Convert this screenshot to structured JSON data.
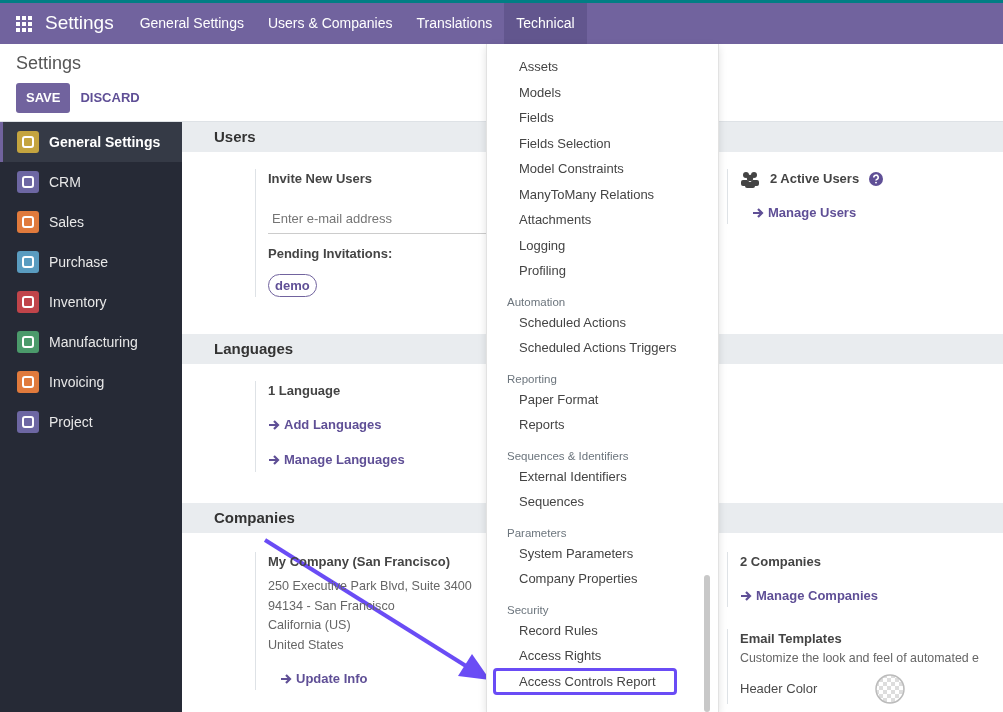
{
  "navbar": {
    "app_title": "Settings",
    "menus": [
      {
        "label": "General Settings",
        "selected": false
      },
      {
        "label": "Users & Companies",
        "selected": false
      },
      {
        "label": "Translations",
        "selected": false
      },
      {
        "label": "Technical",
        "selected": true
      }
    ]
  },
  "control_panel": {
    "title": "Settings",
    "buttons": [
      {
        "label": "SAVE",
        "kind": "primary"
      },
      {
        "label": "DISCARD",
        "kind": "link"
      }
    ]
  },
  "sidebar": {
    "items": [
      {
        "label": "General Settings",
        "selected": true,
        "color": "#c4a43f"
      },
      {
        "label": "CRM",
        "selected": false,
        "color": "#6d67a3"
      },
      {
        "label": "Sales",
        "selected": false,
        "color": "#e07a3c"
      },
      {
        "label": "Purchase",
        "selected": false,
        "color": "#5a9cc0"
      },
      {
        "label": "Inventory",
        "selected": false,
        "color": "#c0444a"
      },
      {
        "label": "Manufacturing",
        "selected": false,
        "color": "#4b9a6b"
      },
      {
        "label": "Invoicing",
        "selected": false,
        "color": "#e07a3c"
      },
      {
        "label": "Project",
        "selected": false,
        "color": "#6d67a3"
      }
    ]
  },
  "sections": [
    {
      "title": "Users",
      "left": [
        {
          "kind": "heading",
          "text": "Invite New Users"
        },
        {
          "kind": "field",
          "placeholder": "Enter e-mail address"
        },
        {
          "kind": "heading",
          "text": "Pending Invitations:"
        },
        {
          "kind": "badge",
          "text": "demo"
        }
      ],
      "right": [
        {
          "kind": "users_stat",
          "text": "2 Active Users"
        },
        {
          "kind": "link",
          "text": "Manage Users",
          "indent": true
        }
      ]
    },
    {
      "title": "Languages",
      "left": [
        {
          "kind": "heading",
          "text": "1 Language"
        },
        {
          "kind": "link",
          "text": "Add Languages"
        },
        {
          "kind": "link",
          "text": "Manage Languages"
        }
      ]
    },
    {
      "title": "Companies",
      "left": [
        {
          "kind": "heading",
          "text": "My Company (San Francisco)"
        },
        {
          "kind": "address",
          "lines": [
            "250 Executive Park Blvd, Suite 3400",
            "94134 - San Francisco",
            "California (US)",
            "United States"
          ]
        },
        {
          "kind": "link",
          "text": "Update Info",
          "indent": true
        }
      ],
      "right": [
        {
          "kind": "heading",
          "text": "2 Companies"
        },
        {
          "kind": "link",
          "text": "Manage Companies"
        },
        {
          "kind": "setting",
          "title": "Email Templates",
          "description": "Customize the look and feel of automated e",
          "options": [
            {
              "label": "Header Color"
            }
          ]
        }
      ]
    }
  ],
  "technical_menu": {
    "sections": [
      {
        "items": [
          {
            "label": "Assets",
            "highlighted": false
          },
          {
            "label": "Models",
            "highlighted": false
          },
          {
            "label": "Fields",
            "highlighted": false
          },
          {
            "label": "Fields Selection",
            "highlighted": false
          },
          {
            "label": "Model Constraints",
            "highlighted": false
          },
          {
            "label": "ManyToMany Relations",
            "highlighted": false
          },
          {
            "label": "Attachments",
            "highlighted": false
          },
          {
            "label": "Logging",
            "highlighted": false
          },
          {
            "label": "Profiling",
            "highlighted": false
          }
        ]
      },
      {
        "header": "Automation",
        "items": [
          {
            "label": "Scheduled Actions",
            "highlighted": false
          },
          {
            "label": "Scheduled Actions Triggers",
            "highlighted": false
          }
        ]
      },
      {
        "header": "Reporting",
        "items": [
          {
            "label": "Paper Format",
            "highlighted": false
          },
          {
            "label": "Reports",
            "highlighted": false
          }
        ]
      },
      {
        "header": "Sequences & Identifiers",
        "items": [
          {
            "label": "External Identifiers",
            "highlighted": false
          },
          {
            "label": "Sequences",
            "highlighted": false
          }
        ]
      },
      {
        "header": "Parameters",
        "items": [
          {
            "label": "System Parameters",
            "highlighted": false
          },
          {
            "label": "Company Properties",
            "highlighted": false
          }
        ]
      },
      {
        "header": "Security",
        "items": [
          {
            "label": "Record Rules",
            "highlighted": false
          },
          {
            "label": "Access Rights",
            "highlighted": false
          },
          {
            "label": "Access Controls Report",
            "highlighted": true
          }
        ]
      }
    ]
  }
}
